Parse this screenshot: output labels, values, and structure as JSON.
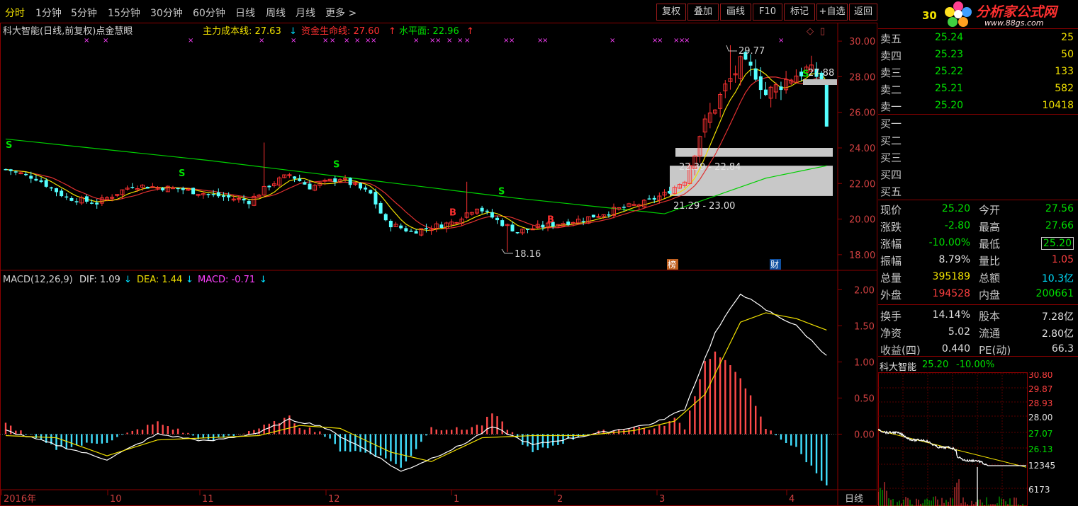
{
  "toolbar": {
    "timeframes": [
      "分时",
      "1分钟",
      "5分钟",
      "15分钟",
      "30分钟",
      "60分钟",
      "日线",
      "周线",
      "月线",
      "更多 >"
    ],
    "buttons": [
      "复权",
      "叠加",
      "画线",
      "F10",
      "标记",
      "+自选",
      "返回"
    ]
  },
  "stock_code_partial": "30",
  "logo": {
    "name": "分析家公式网",
    "url": "www.88gs.com"
  },
  "chart_header": {
    "title": "科大智能(日线,前复权)点金慧眼",
    "ind1": "主力成本线: 27.63",
    "ind1_arrow": "↓",
    "ind2": "资金生命线: 27.60",
    "ind2_arrow": "↑",
    "ind3": "水平面: 22.96",
    "ind3_arrow": "↑"
  },
  "macd_header": {
    "name": "MACD(12,26,9)",
    "dif": "DIF: 1.09",
    "dif_arrow": "↓",
    "dea": "DEA: 1.44",
    "dea_arrow": "↓",
    "macd": "MACD: -0.71",
    "macd_arrow": "↓"
  },
  "annotations": {
    "high": "29.77",
    "low": "18.16",
    "last": "27.88",
    "zone1": "22.39 - 22.84",
    "zone2": "21.29 - 23.00",
    "tag_bang": "榜",
    "tag_cai": "财",
    "bottom_right": "日线"
  },
  "orderbook": {
    "sell": [
      {
        "label": "卖五",
        "price": "25.24",
        "vol": "25"
      },
      {
        "label": "卖四",
        "price": "25.23",
        "vol": "50"
      },
      {
        "label": "卖三",
        "price": "25.22",
        "vol": "133"
      },
      {
        "label": "卖二",
        "price": "25.21",
        "vol": "582"
      },
      {
        "label": "卖一",
        "price": "25.20",
        "vol": "10418"
      }
    ],
    "buy": [
      {
        "label": "买一"
      },
      {
        "label": "买二"
      },
      {
        "label": "买三"
      },
      {
        "label": "买四"
      },
      {
        "label": "买五"
      }
    ]
  },
  "quote": [
    {
      "l1": "现价",
      "v1": "25.20",
      "c1": "g",
      "l2": "今开",
      "v2": "27.56",
      "c2": "g"
    },
    {
      "l1": "涨跌",
      "v1": "-2.80",
      "c1": "g",
      "l2": "最高",
      "v2": "27.66",
      "c2": "g"
    },
    {
      "l1": "涨幅",
      "v1": "-10.00%",
      "c1": "g",
      "l2": "最低",
      "v2": "25.20",
      "c2": "g"
    },
    {
      "l1": "振幅",
      "v1": "8.79%",
      "c1": "w",
      "l2": "量比",
      "v2": "1.05",
      "c2": "r"
    },
    {
      "l1": "总量",
      "v1": "395189",
      "c1": "y",
      "l2": "总额",
      "v2": "10.3亿",
      "c2": "c"
    },
    {
      "l1": "外盘",
      "v1": "194528",
      "c1": "r",
      "l2": "内盘",
      "v2": "200661",
      "c2": "g"
    },
    {
      "l1": "换手",
      "v1": "14.14%",
      "c1": "w",
      "l2": "股本",
      "v2": "7.28亿",
      "c2": "w"
    },
    {
      "l1": "净资",
      "v1": "5.02",
      "c1": "w",
      "l2": "流通",
      "v2": "2.80亿",
      "c2": "w"
    },
    {
      "l1": "收益(四)",
      "v1": "0.440",
      "c1": "w",
      "l2": "PE(动)",
      "v2": "66.3",
      "c2": "w"
    }
  ],
  "mini": {
    "title": "科大智能",
    "price": "25.20",
    "change": "-10.00%",
    "scale": [
      "30.80",
      "29.87",
      "28.93",
      "28.00",
      "27.07",
      "26.13",
      "12345",
      "6173"
    ]
  },
  "chart_data": [
    {
      "type": "candlestick",
      "title": "科大智能(日线,前复权)点金慧眼",
      "y_ticks": [
        "30.00",
        "28.00",
        "26.00",
        "24.00",
        "22.00",
        "20.00",
        "18.00"
      ],
      "ylim": [
        17.2,
        30.8
      ],
      "x_labels": [
        "2016年",
        "10",
        "11",
        "12",
        "1",
        "2",
        "3",
        "4"
      ],
      "notable": {
        "high": 29.77,
        "low": 18.16,
        "last_close": 25.2
      }
    },
    {
      "type": "line",
      "title": "MACD(12,26,9)",
      "y_ticks": [
        "2.00",
        "1.50",
        "1.00",
        "0.50",
        "0.00"
      ],
      "ylim": [
        -0.75,
        2.15
      ],
      "series": [
        {
          "name": "DIF",
          "last": 1.09
        },
        {
          "name": "DEA",
          "last": 1.44
        },
        {
          "name": "MACD",
          "last": -0.71
        }
      ]
    }
  ]
}
